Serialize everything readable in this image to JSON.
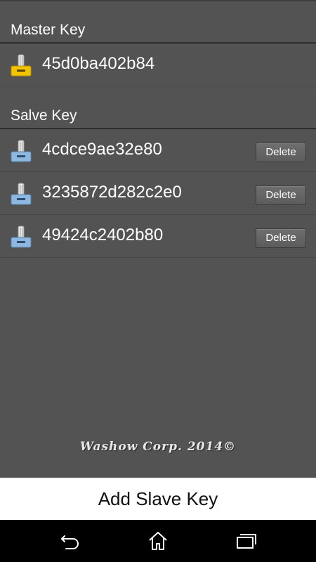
{
  "master_section": {
    "title": "Master Key",
    "key": {
      "id": "45d0ba402b84",
      "icon": "yellow-key-icon"
    }
  },
  "slave_section": {
    "title": "Salve Key",
    "items": [
      {
        "id": "4cdce9ae32e80",
        "icon": "blue-key-icon",
        "delete_label": "Delete"
      },
      {
        "id": "3235872d282c2e0",
        "icon": "blue-key-icon",
        "delete_label": "Delete"
      },
      {
        "id": "49424c2402b80",
        "icon": "blue-key-icon",
        "delete_label": "Delete"
      }
    ]
  },
  "footer": {
    "credit": "Washow Corp. 2014©"
  },
  "add_button": {
    "label": "Add Slave Key"
  },
  "navbar": {
    "icons": [
      "back-icon",
      "home-icon",
      "recent-apps-icon"
    ]
  },
  "colors": {
    "background": "#535353",
    "master_key_icon": "#f2c400",
    "slave_key_icon": "#8fb8e0",
    "navbar": "#000000",
    "add_button_bg": "#ffffff"
  }
}
